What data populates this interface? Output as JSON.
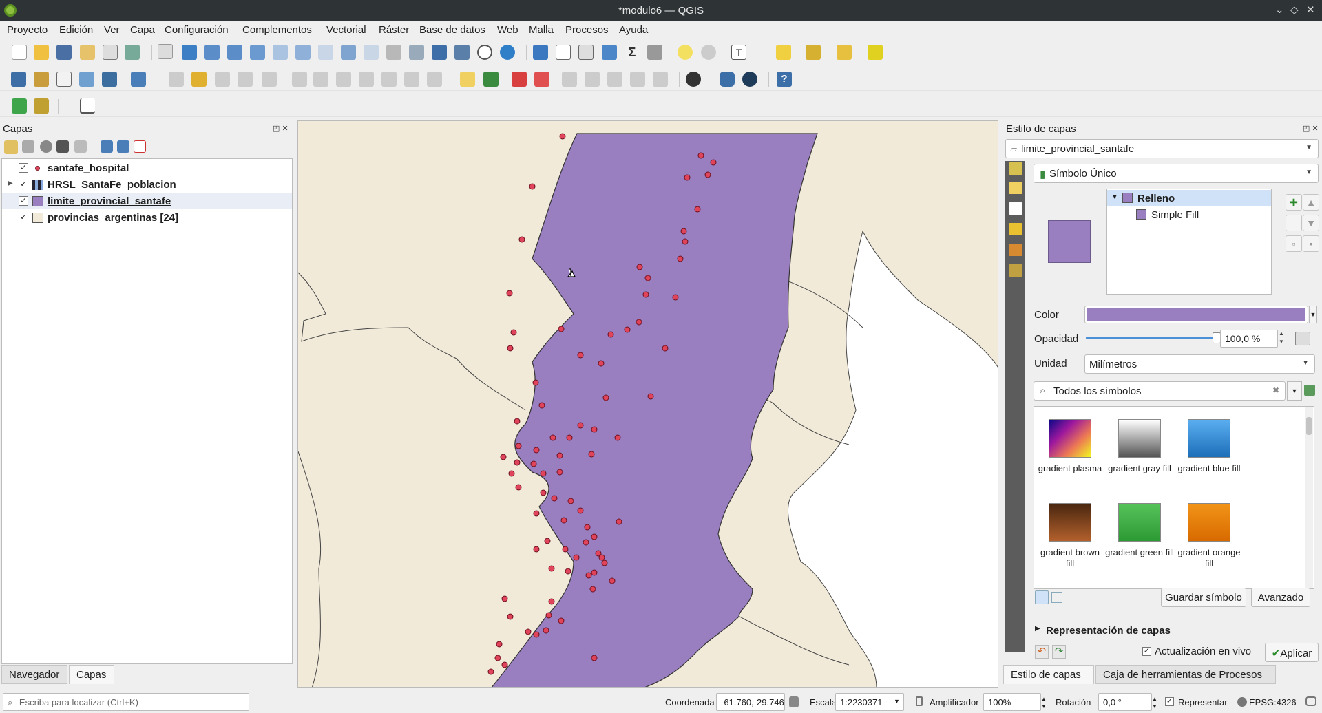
{
  "window": {
    "title": "*modulo6 — QGIS"
  },
  "menu": [
    "Proyecto",
    "Edición",
    "Ver",
    "Capa",
    "Configuración",
    "Complementos",
    "Vectorial",
    "Ráster",
    "Base de datos",
    "Web",
    "Malla",
    "Procesos",
    "Ayuda"
  ],
  "layers_panel": {
    "title": "Capas",
    "layers": [
      {
        "name": "santafe_hospital",
        "checked": true,
        "symbol": "point"
      },
      {
        "name": "HRSL_SantaFe_poblacion",
        "checked": true,
        "symbol": "raster"
      },
      {
        "name": "limite_provincial_santafe",
        "checked": true,
        "symbol": "fill"
      },
      {
        "name": "provincias_argentinas [24]",
        "checked": true,
        "symbol": "fill"
      }
    ],
    "tabs": [
      "Navegador",
      "Capas"
    ]
  },
  "style_panel": {
    "title": "Estilo de capas",
    "layer_combo": "limite_provincial_santafe",
    "renderer_combo": "Símbolo Único",
    "symbol_tree": [
      "Relleno",
      "Simple Fill"
    ],
    "color_label": "Color",
    "color_value": "#9a7fc0",
    "opacity_label": "Opacidad",
    "opacity_value": "100,0 %",
    "unit_label": "Unidad",
    "unit_value": "Milímetros",
    "search_placeholder": "Todos los símbolos",
    "swatches": [
      {
        "label": "gradient plasma",
        "icon": "gradient-plasma"
      },
      {
        "label": "gradient gray fill",
        "icon": "gradient-gray"
      },
      {
        "label": "gradient blue fill",
        "icon": "gradient-blue"
      },
      {
        "label": "gradient brown fill",
        "icon": "gradient-brown"
      },
      {
        "label": "gradient green fill",
        "icon": "gradient-green"
      },
      {
        "label": "gradient orange fill",
        "icon": "gradient-orange"
      }
    ],
    "save_symbol": "Guardar símbolo",
    "advanced": "Avanzado",
    "layer_rendering": "Representación de capas",
    "live_update": "Actualización en vivo",
    "apply": "Aplicar",
    "tabs": [
      "Estilo de capas",
      "Caja de herramientas de Procesos"
    ]
  },
  "statusbar": {
    "locator_placeholder": "Escriba para localizar (Ctrl+K)",
    "coord_label": "Coordenada",
    "coord_value": "-61.760,-29.746",
    "scale_label": "Escala",
    "scale_value": "1:2230371",
    "magnifier_label": "Amplificador",
    "magnifier_value": "100%",
    "rotation_label": "Rotación",
    "rotation_value": "0,0 °",
    "render_label": "Representar",
    "crs": "EPSG:4326"
  },
  "colors": {
    "province_fill": "#9a7fc0",
    "background_land": "#f1ead9",
    "hospital_point": "#e0445a"
  }
}
